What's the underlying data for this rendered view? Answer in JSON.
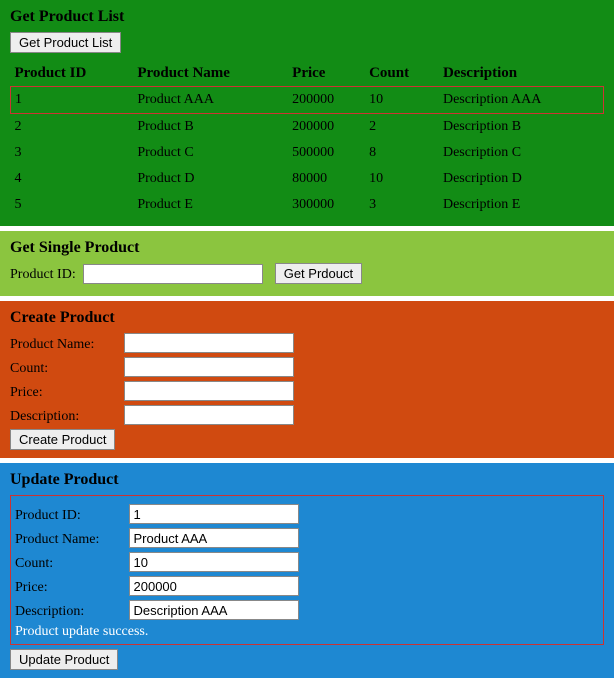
{
  "get_list": {
    "title": "Get Product List",
    "button": "Get Product List",
    "headers": {
      "id": "Product ID",
      "name": "Product Name",
      "price": "Price",
      "count": "Count",
      "desc": "Description"
    },
    "rows": [
      {
        "id": "1",
        "name": "Product AAA",
        "price": "200000",
        "count": "10",
        "desc": "Description AAA",
        "selected": true
      },
      {
        "id": "2",
        "name": "Product B",
        "price": "200000",
        "count": "2",
        "desc": "Description B",
        "selected": false
      },
      {
        "id": "3",
        "name": "Product C",
        "price": "500000",
        "count": "8",
        "desc": "Description C",
        "selected": false
      },
      {
        "id": "4",
        "name": "Product D",
        "price": "80000",
        "count": "10",
        "desc": "Description D",
        "selected": false
      },
      {
        "id": "5",
        "name": "Product E",
        "price": "300000",
        "count": "3",
        "desc": "Description E",
        "selected": false
      }
    ]
  },
  "get_single": {
    "title": "Get Single Product",
    "label_id": "Product ID:",
    "value_id": "",
    "button": "Get Prdouct"
  },
  "create": {
    "title": "Create Product",
    "label_name": "Product Name:",
    "label_count": "Count:",
    "label_price": "Price:",
    "label_desc": "Description:",
    "value_name": "",
    "value_count": "",
    "value_price": "",
    "value_desc": "",
    "button": "Create Product"
  },
  "update": {
    "title": "Update Product",
    "label_id": "Product ID:",
    "label_name": "Product Name:",
    "label_count": "Count:",
    "label_price": "Price:",
    "label_desc": "Description:",
    "value_id": "1",
    "value_name": "Product AAA",
    "value_count": "10",
    "value_price": "200000",
    "value_desc": "Description AAA",
    "status": "Product update success.",
    "button": "Update Product"
  }
}
